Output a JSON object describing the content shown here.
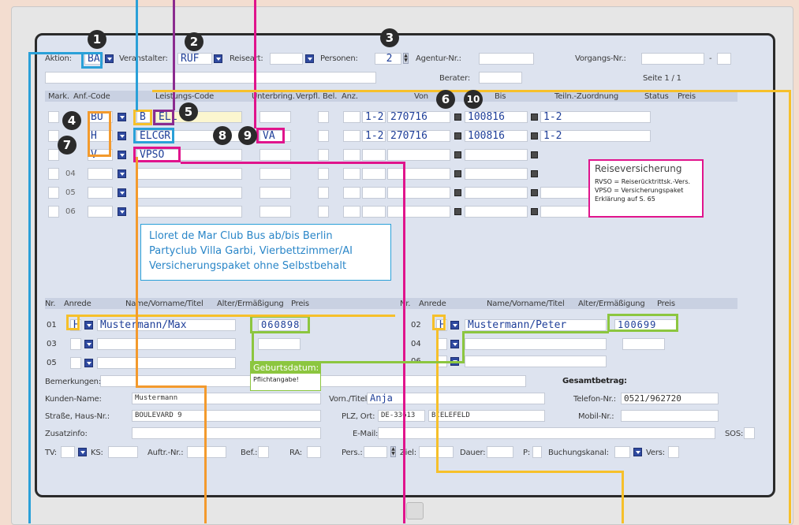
{
  "header": {
    "aktion_label": "Aktion:",
    "aktion_value": "BA",
    "veranstalter_label": "Veranstalter:",
    "veranstalter_value": "RUF",
    "reiseart_label": "Reiseart:",
    "personen_label": "Personen:",
    "personen_value": "2",
    "agentur_label": "Agentur-Nr.:",
    "vorgang_label": "Vorgangs-Nr.:",
    "vorgang_sep": "-",
    "berater_label": "Berater:",
    "seite": "Seite 1 / 1"
  },
  "service_table": {
    "columns": [
      "Mark.",
      "Anf.-Code",
      "Leistungs-Code",
      "Unterbring.",
      "Verpfl.",
      "Bel.",
      "Anz.",
      "Von",
      "Bis",
      "Teiln.-Zuordnung",
      "Status",
      "Preis"
    ],
    "rows": [
      {
        "nr": "01",
        "anf": "BU",
        "leistung_a": "B",
        "leistung_b": "ELL",
        "unterbring": "",
        "anz": "1-2",
        "von": "270716",
        "bis": "100816",
        "teiln": "1-2"
      },
      {
        "nr": "02",
        "anf": "H",
        "leistung_a": "ELCGR",
        "leistung_b": "",
        "unterbring": "VA",
        "anz": "1-2",
        "von": "270716",
        "bis": "100816",
        "teiln": "1-2"
      },
      {
        "nr": "03",
        "anf": "V",
        "leistung_a": "VPSO",
        "leistung_b": "",
        "unterbring": "",
        "anz": "",
        "von": "",
        "bis": "",
        "teiln": ""
      },
      {
        "nr": "04",
        "anf": "",
        "leistung_a": "",
        "leistung_b": "",
        "unterbring": "",
        "anz": "",
        "von": "",
        "bis": "",
        "teiln": ""
      },
      {
        "nr": "05",
        "anf": "",
        "leistung_a": "",
        "leistung_b": "",
        "unterbring": "",
        "anz": "",
        "von": "",
        "bis": "",
        "teiln": ""
      },
      {
        "nr": "06",
        "anf": "",
        "leistung_a": "",
        "leistung_b": "",
        "unterbring": "",
        "anz": "",
        "von": "",
        "bis": "",
        "teiln": ""
      }
    ]
  },
  "info_box": {
    "line1": "Lloret de Mar Club Bus ab/bis Berlin",
    "line2": "Partyclub Villa Garbi, Vierbettzimmer/AI",
    "line3": "Versicherungspaket ohne Selbstbehalt"
  },
  "insurance_note": {
    "title": "Reiseversicherung",
    "line1": "RVSO = Reiserücktrittsk.-Vers.",
    "line2": "VPSO = Versicherungspaket",
    "line3": "Erklärung auf S. 65"
  },
  "participants": {
    "columns": [
      "Nr.",
      "Anrede",
      "Name/Vorname/Titel",
      "Alter/Ermäßigung",
      "Preis"
    ],
    "left": [
      {
        "nr": "01",
        "anrede": "H",
        "name": "Mustermann/Max",
        "alter": "060898"
      },
      {
        "nr": "03",
        "anrede": "",
        "name": "",
        "alter": ""
      },
      {
        "nr": "05",
        "anrede": "",
        "name": "",
        "alter": ""
      }
    ],
    "right": [
      {
        "nr": "02",
        "anrede": "H",
        "name": "Mustermann/Peter",
        "alter": "100699"
      },
      {
        "nr": "04",
        "anrede": "",
        "name": "",
        "alter": ""
      },
      {
        "nr": "06",
        "anrede": "",
        "name": "",
        "alter": ""
      }
    ]
  },
  "birth_note": {
    "title": "Geburtsdatum:",
    "text": "Pflichtangabe!"
  },
  "customer": {
    "bemerkungen_label": "Bemerkungen:",
    "gesamtbetrag_label": "Gesamtbetrag:",
    "kunden_name_label": "Kunden-Name:",
    "kunden_name_value": "Mustermann",
    "vorname_label": "Vorn./Titel:",
    "vorname_value": "Anja",
    "telefon_label": "Telefon-Nr.:",
    "telefon_value": "0521/962720",
    "strasse_label": "Straße, Haus-Nr.:",
    "strasse_value": "BOULEVARD 9",
    "plz_label": "PLZ, Ort:",
    "plz_value": "DE-33613",
    "ort_value": "BIELEFELD",
    "mobil_label": "Mobil-Nr.:",
    "zusatzinfo_label": "Zusatzinfo:",
    "email_label": "E-Mail:",
    "sos_label": "SOS:"
  },
  "footer": {
    "tv": "TV:",
    "ks": "KS:",
    "auftr": "Auftr.-Nr.:",
    "bef": "Bef.:",
    "ra": "RA:",
    "pers": "Pers.:",
    "ziel": "Ziel:",
    "dauer": "Dauer:",
    "p": "P:",
    "buchungskanal": "Buchungskanal:",
    "vers": "Vers:"
  },
  "badges": [
    "1",
    "2",
    "3",
    "4",
    "5",
    "6",
    "7",
    "8",
    "9",
    "10"
  ],
  "colors": {
    "blue": "#2aa0d8",
    "magenta": "#e0148c",
    "yellow": "#f6c02a",
    "orange": "#f39a2d",
    "green": "#8cc63f",
    "purple": "#8b2b8f"
  }
}
